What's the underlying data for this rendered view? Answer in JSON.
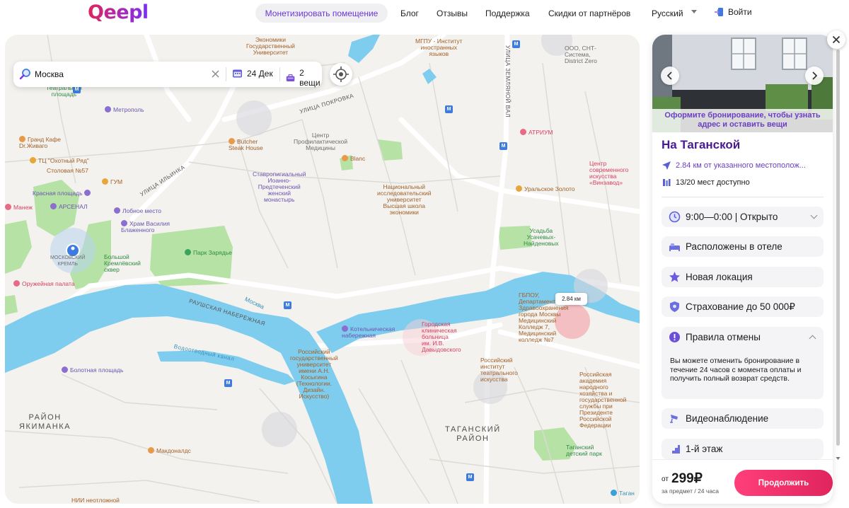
{
  "header": {
    "logo": "Qeepl",
    "nav": {
      "monetize": "Монетизировать помещение",
      "blog": "Блог",
      "reviews": "Отзывы",
      "support": "Поддержка",
      "partners": "Скидки от партнёров",
      "language": "Русский",
      "login": "Войти"
    }
  },
  "search": {
    "location_value": "Москва",
    "date": "24 Дек",
    "items": "2 вещи"
  },
  "map": {
    "distance_badge": "2.84 км",
    "labels": {
      "economics_univ": "Экономики\nГосударственный\nУниверситет",
      "mgpu": "МГПУ - Институт\nиностранных\nязыков",
      "zemlyanoy_val": "УЛИЦА ЗЕМЛЯНОЙ ВАЛ",
      "sht_system": "ООО, СНТ-\nСистема,\nDistrict Zero",
      "metropol": "Метрополь",
      "teatr_sq": "Театральная\nплощадь",
      "pokrovka": "УЛИЦА ПОКРОВКА",
      "atrium": "АТРИУМ",
      "grand_cafe": "Гранд Кафе\nDr.Живаго",
      "ohotny": "ТЦ \"Охотный Ряд\"",
      "stolovaya": "Столовая №57",
      "gum": "ГУМ",
      "butcher": "Butcher\nSteak House",
      "prevention": "Центр\nПрофилактической\nМедицины",
      "blanc": "Blanc",
      "modern_art": "Центр\nсовременного\nискусства\n«Винзавод»",
      "red_square": "Красная площадь",
      "ilinka": "УЛИЦА ИЛЬИНКА",
      "manezh": "Манеж",
      "arsenal": "АРСЕНАЛ",
      "lobnoe": "Лобное место",
      "stavropigial": "Ставропигиальный\nИоанно-\nПредтеченский\nженский\nмонастырь",
      "hse": "Национальный\nисследовательский\nуниверситет\nВысшая школа\nэкономики",
      "ural_gold": "Уральское Золото",
      "basil": "Храм Василия\nБлаженного",
      "usadba": "Усадьба\nУсачевых-\nНайденовых",
      "kremlin": "МОСКОВСКИЙ\nКРЕМЛЬ",
      "zaryadye": "Парк Зарядье",
      "kremlin_square": "Большой\nКремлёвский\nсквер",
      "armoury": "Оружейная палата",
      "raushskaya": "РАУШСКАЯ НАБЕРЕЖНАЯ",
      "moskva_river": "Москва",
      "gbpu": "ГБПОУ,\nДепартамент\nЗдравоохранения\nгорода Москвы\nМедицинский\nКолледж 7,\nМедицинский\nколледж №7",
      "kotelnicheskaya": "Котельническая\nнабережная",
      "hospital": "Городская\nклиническая\nбольница\nим. И.В.\nДавыдовского",
      "kosygin": "Российский\nгосударственный\nуниверситет\nимени А.Н.\nКосыгина\n(Технологии.\nДизайн.\nИскусство)",
      "vodootvodny": "Водоотводный канал",
      "bolotnaya": "Болотная площадь",
      "gitis": "Российский\nинститут\nтеатрального\nискусства",
      "ranepa": "Российская\nакадемия\nнародного\nхозяйства и\nгосударственной\nслужбы при\nПрезиденте\nРоссийской\nФедерации",
      "yakimanka": "РАЙОН\nЯКИМАНКА",
      "taganka_district": "ТАГАНСКИЙ\nРАЙОН",
      "mcdonalds": "Макдоналдс",
      "taganka_park": "Таганский\nдетский парк",
      "nii": "НИИ неотложной",
      "taganskaya": "Таган"
    }
  },
  "panel": {
    "overlay": "Оформите бронирование, чтобы узнать адрес и оставить вещи",
    "title": "На Таганской",
    "distance": "2.84 км от указанного местополож...",
    "seats": "13/20 мест доступно",
    "hours": "9:00—0:00 | Открыто",
    "features": {
      "hotel": "Расположены в отеле",
      "new": "Новая локация",
      "insurance": "Страхование до 50 000₽",
      "cancel": "Правила отмены",
      "cancel_text": "Вы можете отменить бронирование в течение 24 часов с момента оплаты и получить полный возврат средств.",
      "cctv": "Видеонаблюдение",
      "floor": "1-й этаж"
    },
    "price_from": "от",
    "price": "299₽",
    "price_note": "за предмет / 24 часа",
    "cta": "Продолжить"
  },
  "colors": {
    "brand_purple": "#6b3fc4",
    "brand_pink": "#e0245e",
    "water": "#6ec6ea",
    "park": "#a9dc9a"
  }
}
